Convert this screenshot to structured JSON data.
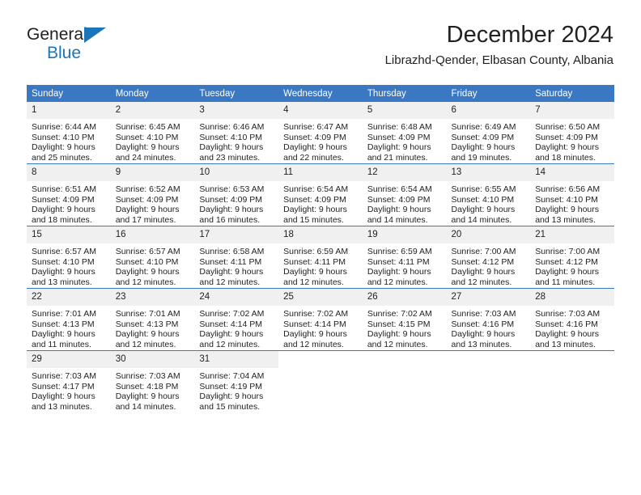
{
  "brand": {
    "name_top": "General",
    "name_bottom": "Blue",
    "accent_color": "#1b75bb"
  },
  "header": {
    "month_title": "December 2024",
    "location": "Librazhd-Qender, Elbasan County, Albania"
  },
  "theme": {
    "header_bg": "#3b78c3",
    "daynum_bg": "#f0f0f0",
    "row_divider": "#3b78c3",
    "text": "#222222"
  },
  "calendar": {
    "weekday_headers": [
      "Sunday",
      "Monday",
      "Tuesday",
      "Wednesday",
      "Thursday",
      "Friday",
      "Saturday"
    ],
    "weeks": [
      [
        {
          "day": "1",
          "sunrise": "Sunrise: 6:44 AM",
          "sunset": "Sunset: 4:10 PM",
          "daylight_1": "Daylight: 9 hours",
          "daylight_2": "and 25 minutes."
        },
        {
          "day": "2",
          "sunrise": "Sunrise: 6:45 AM",
          "sunset": "Sunset: 4:10 PM",
          "daylight_1": "Daylight: 9 hours",
          "daylight_2": "and 24 minutes."
        },
        {
          "day": "3",
          "sunrise": "Sunrise: 6:46 AM",
          "sunset": "Sunset: 4:10 PM",
          "daylight_1": "Daylight: 9 hours",
          "daylight_2": "and 23 minutes."
        },
        {
          "day": "4",
          "sunrise": "Sunrise: 6:47 AM",
          "sunset": "Sunset: 4:09 PM",
          "daylight_1": "Daylight: 9 hours",
          "daylight_2": "and 22 minutes."
        },
        {
          "day": "5",
          "sunrise": "Sunrise: 6:48 AM",
          "sunset": "Sunset: 4:09 PM",
          "daylight_1": "Daylight: 9 hours",
          "daylight_2": "and 21 minutes."
        },
        {
          "day": "6",
          "sunrise": "Sunrise: 6:49 AM",
          "sunset": "Sunset: 4:09 PM",
          "daylight_1": "Daylight: 9 hours",
          "daylight_2": "and 19 minutes."
        },
        {
          "day": "7",
          "sunrise": "Sunrise: 6:50 AM",
          "sunset": "Sunset: 4:09 PM",
          "daylight_1": "Daylight: 9 hours",
          "daylight_2": "and 18 minutes."
        }
      ],
      [
        {
          "day": "8",
          "sunrise": "Sunrise: 6:51 AM",
          "sunset": "Sunset: 4:09 PM",
          "daylight_1": "Daylight: 9 hours",
          "daylight_2": "and 18 minutes."
        },
        {
          "day": "9",
          "sunrise": "Sunrise: 6:52 AM",
          "sunset": "Sunset: 4:09 PM",
          "daylight_1": "Daylight: 9 hours",
          "daylight_2": "and 17 minutes."
        },
        {
          "day": "10",
          "sunrise": "Sunrise: 6:53 AM",
          "sunset": "Sunset: 4:09 PM",
          "daylight_1": "Daylight: 9 hours",
          "daylight_2": "and 16 minutes."
        },
        {
          "day": "11",
          "sunrise": "Sunrise: 6:54 AM",
          "sunset": "Sunset: 4:09 PM",
          "daylight_1": "Daylight: 9 hours",
          "daylight_2": "and 15 minutes."
        },
        {
          "day": "12",
          "sunrise": "Sunrise: 6:54 AM",
          "sunset": "Sunset: 4:09 PM",
          "daylight_1": "Daylight: 9 hours",
          "daylight_2": "and 14 minutes."
        },
        {
          "day": "13",
          "sunrise": "Sunrise: 6:55 AM",
          "sunset": "Sunset: 4:10 PM",
          "daylight_1": "Daylight: 9 hours",
          "daylight_2": "and 14 minutes."
        },
        {
          "day": "14",
          "sunrise": "Sunrise: 6:56 AM",
          "sunset": "Sunset: 4:10 PM",
          "daylight_1": "Daylight: 9 hours",
          "daylight_2": "and 13 minutes."
        }
      ],
      [
        {
          "day": "15",
          "sunrise": "Sunrise: 6:57 AM",
          "sunset": "Sunset: 4:10 PM",
          "daylight_1": "Daylight: 9 hours",
          "daylight_2": "and 13 minutes."
        },
        {
          "day": "16",
          "sunrise": "Sunrise: 6:57 AM",
          "sunset": "Sunset: 4:10 PM",
          "daylight_1": "Daylight: 9 hours",
          "daylight_2": "and 12 minutes."
        },
        {
          "day": "17",
          "sunrise": "Sunrise: 6:58 AM",
          "sunset": "Sunset: 4:11 PM",
          "daylight_1": "Daylight: 9 hours",
          "daylight_2": "and 12 minutes."
        },
        {
          "day": "18",
          "sunrise": "Sunrise: 6:59 AM",
          "sunset": "Sunset: 4:11 PM",
          "daylight_1": "Daylight: 9 hours",
          "daylight_2": "and 12 minutes."
        },
        {
          "day": "19",
          "sunrise": "Sunrise: 6:59 AM",
          "sunset": "Sunset: 4:11 PM",
          "daylight_1": "Daylight: 9 hours",
          "daylight_2": "and 12 minutes."
        },
        {
          "day": "20",
          "sunrise": "Sunrise: 7:00 AM",
          "sunset": "Sunset: 4:12 PM",
          "daylight_1": "Daylight: 9 hours",
          "daylight_2": "and 12 minutes."
        },
        {
          "day": "21",
          "sunrise": "Sunrise: 7:00 AM",
          "sunset": "Sunset: 4:12 PM",
          "daylight_1": "Daylight: 9 hours",
          "daylight_2": "and 11 minutes."
        }
      ],
      [
        {
          "day": "22",
          "sunrise": "Sunrise: 7:01 AM",
          "sunset": "Sunset: 4:13 PM",
          "daylight_1": "Daylight: 9 hours",
          "daylight_2": "and 11 minutes."
        },
        {
          "day": "23",
          "sunrise": "Sunrise: 7:01 AM",
          "sunset": "Sunset: 4:13 PM",
          "daylight_1": "Daylight: 9 hours",
          "daylight_2": "and 12 minutes."
        },
        {
          "day": "24",
          "sunrise": "Sunrise: 7:02 AM",
          "sunset": "Sunset: 4:14 PM",
          "daylight_1": "Daylight: 9 hours",
          "daylight_2": "and 12 minutes."
        },
        {
          "day": "25",
          "sunrise": "Sunrise: 7:02 AM",
          "sunset": "Sunset: 4:14 PM",
          "daylight_1": "Daylight: 9 hours",
          "daylight_2": "and 12 minutes."
        },
        {
          "day": "26",
          "sunrise": "Sunrise: 7:02 AM",
          "sunset": "Sunset: 4:15 PM",
          "daylight_1": "Daylight: 9 hours",
          "daylight_2": "and 12 minutes."
        },
        {
          "day": "27",
          "sunrise": "Sunrise: 7:03 AM",
          "sunset": "Sunset: 4:16 PM",
          "daylight_1": "Daylight: 9 hours",
          "daylight_2": "and 13 minutes."
        },
        {
          "day": "28",
          "sunrise": "Sunrise: 7:03 AM",
          "sunset": "Sunset: 4:16 PM",
          "daylight_1": "Daylight: 9 hours",
          "daylight_2": "and 13 minutes."
        }
      ],
      [
        {
          "day": "29",
          "sunrise": "Sunrise: 7:03 AM",
          "sunset": "Sunset: 4:17 PM",
          "daylight_1": "Daylight: 9 hours",
          "daylight_2": "and 13 minutes."
        },
        {
          "day": "30",
          "sunrise": "Sunrise: 7:03 AM",
          "sunset": "Sunset: 4:18 PM",
          "daylight_1": "Daylight: 9 hours",
          "daylight_2": "and 14 minutes."
        },
        {
          "day": "31",
          "sunrise": "Sunrise: 7:04 AM",
          "sunset": "Sunset: 4:19 PM",
          "daylight_1": "Daylight: 9 hours",
          "daylight_2": "and 15 minutes."
        },
        {
          "day": "",
          "sunrise": "",
          "sunset": "",
          "daylight_1": "",
          "daylight_2": ""
        },
        {
          "day": "",
          "sunrise": "",
          "sunset": "",
          "daylight_1": "",
          "daylight_2": ""
        },
        {
          "day": "",
          "sunrise": "",
          "sunset": "",
          "daylight_1": "",
          "daylight_2": ""
        },
        {
          "day": "",
          "sunrise": "",
          "sunset": "",
          "daylight_1": "",
          "daylight_2": ""
        }
      ]
    ]
  }
}
